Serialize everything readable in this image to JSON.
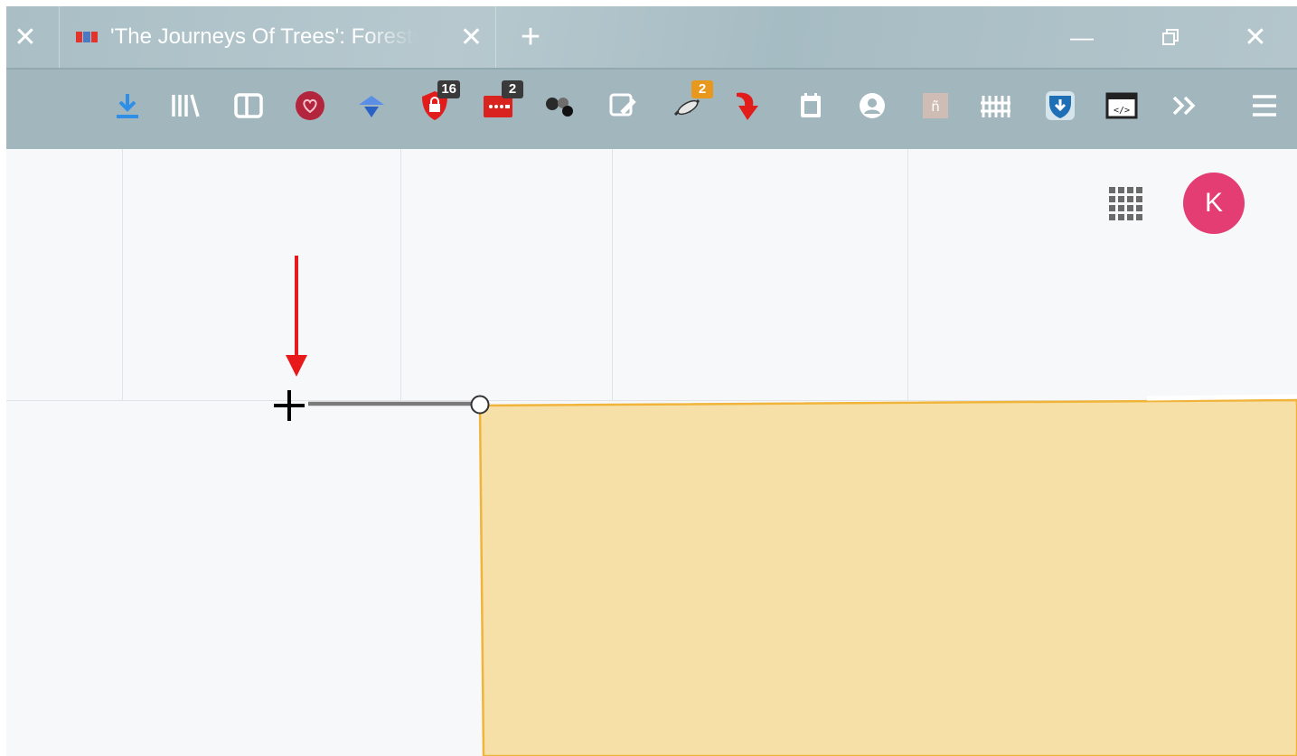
{
  "browser": {
    "tab": {
      "title": "'The Journeys Of Trees': Forests",
      "favicon_colors": [
        "#e4332d",
        "#4c7ac2",
        "#e4332d",
        "#4c7ac2"
      ],
      "close_icon": "close-icon"
    },
    "left_close_icon": "close-icon",
    "new_tab_icon": "plus-icon",
    "window_controls": [
      "minimize-icon",
      "restore-icon",
      "close-icon"
    ]
  },
  "toolbar": {
    "items": [
      {
        "name": "download-icon",
        "badge": ""
      },
      {
        "name": "library-icon",
        "badge": ""
      },
      {
        "name": "sidebar-icon",
        "badge": ""
      },
      {
        "name": "pocket-icon",
        "badge": ""
      },
      {
        "name": "blue-extension-icon",
        "badge": ""
      },
      {
        "name": "shield-lock-extension-icon",
        "badge": "16"
      },
      {
        "name": "password-extension-icon",
        "badge": "2"
      },
      {
        "name": "molecule-extension-icon",
        "badge": ""
      },
      {
        "name": "edit-screenshot-icon",
        "badge": ""
      },
      {
        "name": "mouse-gesture-icon",
        "badge": "2"
      },
      {
        "name": "red-arrow-extension-icon",
        "badge": ""
      },
      {
        "name": "notes-icon",
        "badge": ""
      },
      {
        "name": "account-circle-icon",
        "badge": ""
      },
      {
        "name": "tile-extension-icon",
        "badge": ""
      },
      {
        "name": "fence-extension-icon",
        "badge": ""
      },
      {
        "name": "shield-download-icon",
        "badge": ""
      },
      {
        "name": "code-window-icon",
        "badge": ""
      },
      {
        "name": "overflow-chevrons-icon",
        "badge": ""
      },
      {
        "name": "hamburger-menu-icon",
        "badge": ""
      }
    ]
  },
  "page": {
    "apps_icon": "apps-grid-icon",
    "avatar_letter": "K",
    "avatar_color": "#e33d73",
    "shape_fill": "#f7e0a7",
    "shape_stroke": "#f0b43a",
    "annotation_arrow_color": "#e8191a",
    "crosshair_icon": "crosshair-cursor-icon"
  }
}
